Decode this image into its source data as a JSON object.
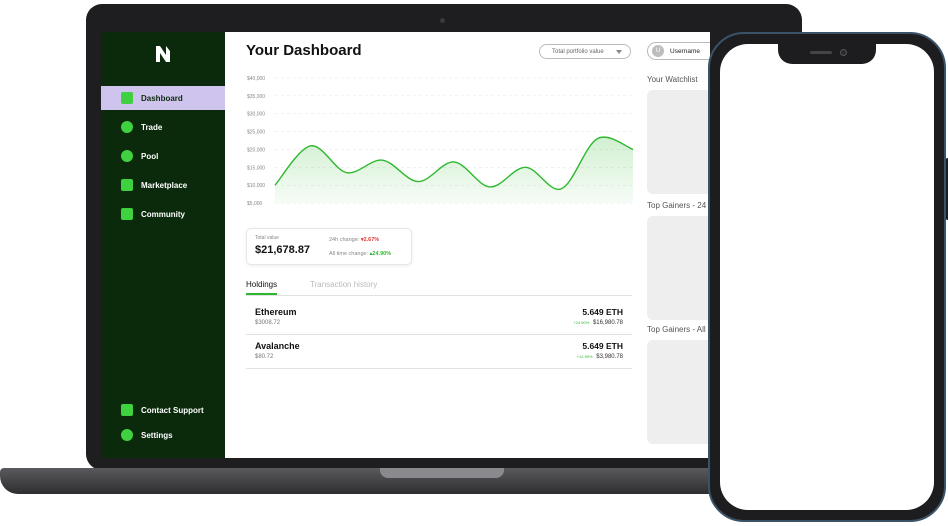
{
  "sidebar": {
    "items": [
      {
        "label": "Dashboard"
      },
      {
        "label": "Trade"
      },
      {
        "label": "Pool"
      },
      {
        "label": "Marketplace"
      },
      {
        "label": "Community"
      }
    ],
    "footer": [
      {
        "label": "Contact Support"
      },
      {
        "label": "Settings"
      }
    ]
  },
  "header": {
    "title": "Your Dashboard",
    "dropdown": "Total portfolio value",
    "user": {
      "initial": "U",
      "name": "Username"
    }
  },
  "chart_data": {
    "type": "area",
    "yticks": [
      "$40,000",
      "$35,000",
      "$30,000",
      "$25,000",
      "$20,000",
      "$15,000",
      "$10,000",
      "$5,000"
    ],
    "ylim": [
      5000,
      40000
    ],
    "values": [
      10000,
      21000,
      13500,
      17000,
      11000,
      16500,
      9500,
      15000,
      9000,
      23000,
      20000
    ],
    "color": "#2eb82e"
  },
  "summary": {
    "total_label": "Total value",
    "total_value": "$21,678.87",
    "change_24h_label": "24h change:",
    "change_24h_value": "▾2.67%",
    "all_time_label": "All time change:",
    "all_time_value": "▴24.90%"
  },
  "tabs": [
    "Holdings",
    "Transaction history"
  ],
  "holdings": [
    {
      "name": "Ethereum",
      "price": "$3008.72",
      "amount": "5.649 ETH",
      "change": "+24.90%",
      "value": "$16,980.78"
    },
    {
      "name": "Avalanche",
      "price": "$80.72",
      "amount": "5.649 ETH",
      "change": "+12.99%",
      "value": "$3,980.78"
    }
  ],
  "right_panel": {
    "watchlist": "Your Watchlist",
    "gainers_24h": "Top Gainers - 24",
    "gainers_all": "Top Gainers - All"
  }
}
